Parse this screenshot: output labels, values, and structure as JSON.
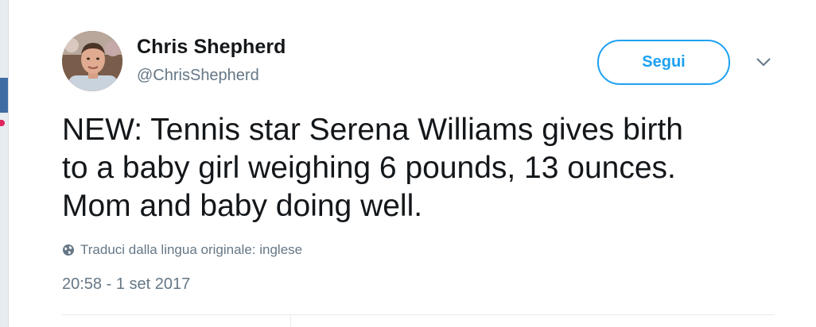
{
  "tweet": {
    "author": {
      "display_name": "Chris Shepherd",
      "handle": "@ChrisShepherd"
    },
    "follow_label": "Segui",
    "text": "NEW: Tennis star Serena Williams gives birth\nto a baby girl weighing 6 pounds, 13 ounces.\nMom and baby doing well.",
    "translate_label": "Traduci dalla lingua originale: inglese",
    "timestamp": "20:58 - 1 set 2017"
  },
  "colors": {
    "accent": "#1da1f2",
    "text_primary": "#14171a",
    "text_secondary": "#657786"
  },
  "icons": {
    "avatar": "profile-photo",
    "menu": "chevron-down-icon",
    "translate": "globe-icon"
  }
}
